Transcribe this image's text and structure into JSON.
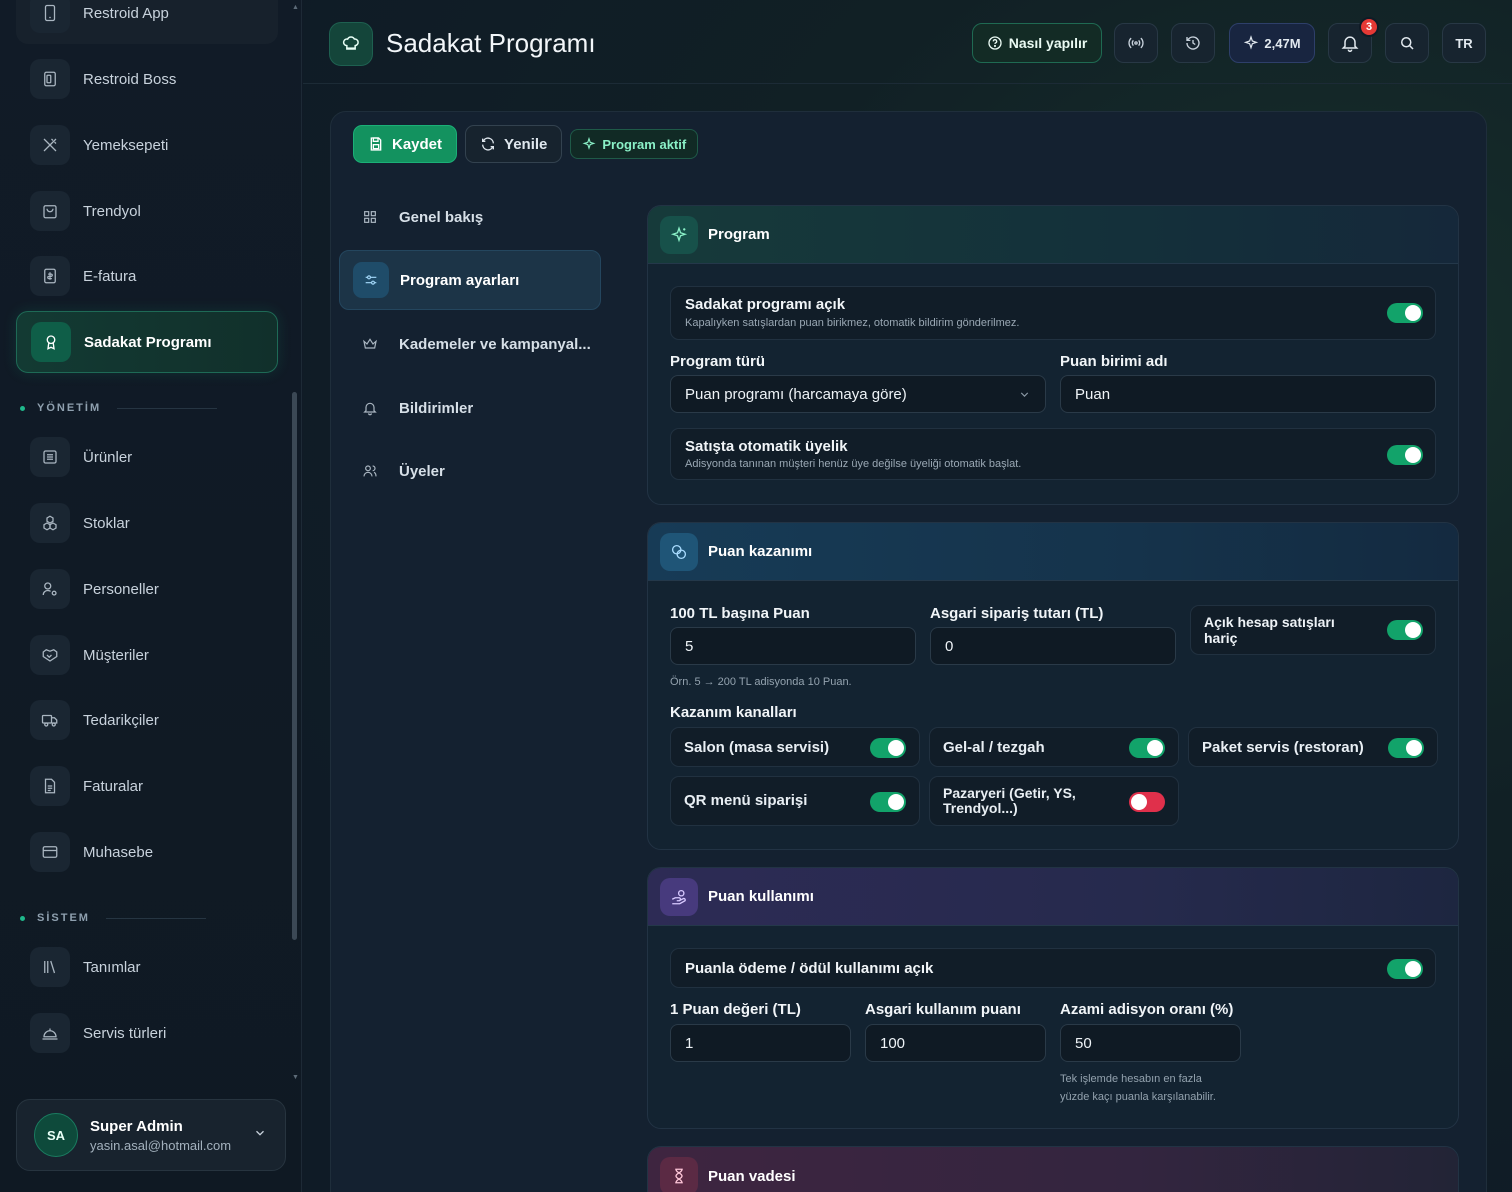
{
  "sidebar": {
    "items_top": [
      {
        "label": "Restroid App",
        "icon": "mobile-icon"
      },
      {
        "label": "Restroid Boss",
        "icon": "tablet-icon"
      },
      {
        "label": "Yemeksepeti",
        "icon": "utensils-icon"
      },
      {
        "label": "Trendyol",
        "icon": "shopping-bag-icon"
      },
      {
        "label": "E-fatura",
        "icon": "invoice-icon"
      },
      {
        "label": "Sadakat Programı",
        "icon": "award-icon",
        "active": true
      }
    ],
    "section_management": "YÖNETİM",
    "items_management": [
      {
        "label": "Ürünler",
        "icon": "list-icon"
      },
      {
        "label": "Stoklar",
        "icon": "boxes-icon"
      },
      {
        "label": "Personeller",
        "icon": "user-gear-icon"
      },
      {
        "label": "Müşteriler",
        "icon": "handshake-icon"
      },
      {
        "label": "Tedarikçiler",
        "icon": "truck-icon"
      },
      {
        "label": "Faturalar",
        "icon": "file-icon"
      },
      {
        "label": "Muhasebe",
        "icon": "wallet-icon"
      }
    ],
    "section_system": "SİSTEM",
    "items_system": [
      {
        "label": "Tanımlar",
        "icon": "library-icon"
      },
      {
        "label": "Servis türleri",
        "icon": "service-bell-icon"
      }
    ],
    "user": {
      "initials": "SA",
      "name": "Super Admin",
      "email": "yasin.asal@hotmail.com"
    }
  },
  "topbar": {
    "title": "Sadakat Programı",
    "help_label": "Nasıl yapılır",
    "stats_label": "2,47M",
    "notification_count": "3",
    "language": "TR"
  },
  "toolbar": {
    "save_label": "Kaydet",
    "refresh_label": "Yenile",
    "status_label": "Program aktif"
  },
  "subnav": [
    {
      "label": "Genel bakış",
      "icon": "grid-icon"
    },
    {
      "label": "Program ayarları",
      "icon": "sliders-icon",
      "active": true
    },
    {
      "label": "Kademeler ve kampanyal...",
      "icon": "crown-icon"
    },
    {
      "label": "Bildirimler",
      "icon": "bell-icon"
    },
    {
      "label": "Üyeler",
      "icon": "users-icon"
    }
  ],
  "program": {
    "title": "Program",
    "enabled": {
      "title": "Sadakat programı açık",
      "desc": "Kapalıyken satışlardan puan birikmez, otomatik bildirim gönderilmez.",
      "on": true
    },
    "type_label": "Program türü",
    "type_value": "Puan programı (harcamaya göre)",
    "unit_label": "Puan birimi adı",
    "unit_value": "Puan",
    "auto_member": {
      "title": "Satışta otomatik üyelik",
      "desc": "Adisyonda tanınan müşteri henüz üye değilse üyeliği otomatik başlat.",
      "on": true
    }
  },
  "earning": {
    "title": "Puan kazanımı",
    "per100_label": "100 TL başına Puan",
    "per100_value": "5",
    "min_order_label": "Asgari sipariş tutarı (TL)",
    "min_order_value": "0",
    "open_account_label": "Açık hesap satışları hariç",
    "open_account_on": true,
    "example": "Örn. 5 → 200 TL adisyonda 10 Puan.",
    "channels_label": "Kazanım kanalları",
    "channels": [
      {
        "label": "Salon (masa servisi)",
        "on": true
      },
      {
        "label": "Gel-al / tezgah",
        "on": true
      },
      {
        "label": "Paket servis (restoran)",
        "on": true
      },
      {
        "label": "QR menü siparişi",
        "on": true
      },
      {
        "label": "Pazaryeri (Getir, YS, Trendyol...)",
        "on": false
      }
    ]
  },
  "usage": {
    "title": "Puan kullanımı",
    "enabled_label": "Puanla ödeme / ödül kullanımı açık",
    "enabled_on": true,
    "point_value_label": "1 Puan değeri (TL)",
    "point_value": "1",
    "min_points_label": "Asgari kullanım puanı",
    "min_points": "100",
    "max_ratio_label": "Azami adisyon oranı (%)",
    "max_ratio": "50",
    "max_ratio_hint_1": "Tek işlemde hesabın en fazla",
    "max_ratio_hint_2": "yüzde kaçı puanla karşılanabilir."
  },
  "expiry": {
    "title": "Puan vadesi"
  },
  "colors": {
    "accent": "#13925f",
    "toggle_on": "#12a36a",
    "toggle_off": "#e0304b",
    "badge": "#e53935"
  }
}
